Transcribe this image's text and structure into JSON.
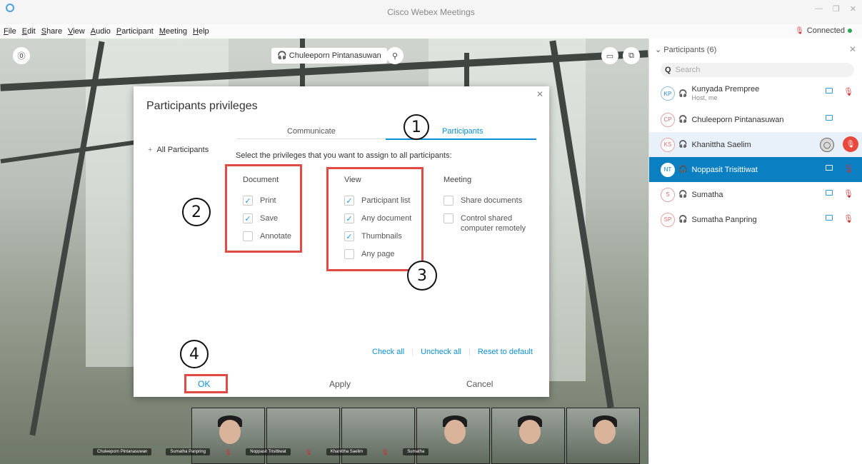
{
  "window": {
    "title": "Cisco Webex Meetings",
    "controls": [
      "—",
      "❐",
      "✕"
    ]
  },
  "menu": [
    "File",
    "Edit",
    "Share",
    "View",
    "Audio",
    "Participant",
    "Meeting",
    "Help"
  ],
  "connection": {
    "status": "Connected",
    "status_color": "#2aa655"
  },
  "stage": {
    "active_speaker": "Chuleeporn Pintanasuwan",
    "thumbnails": [
      {
        "name": "Chuleeporn Pintanasuwan",
        "muted": false
      },
      {
        "name": "Sumatha Panpring",
        "muted": true
      },
      {
        "name": "Noppasit Trisittiwat",
        "muted": true
      },
      {
        "name": "Khanittha Saelim",
        "muted": true
      },
      {
        "name": "Sumatha",
        "muted": true
      }
    ]
  },
  "dialog": {
    "title": "Participants privileges",
    "tabs": [
      {
        "label": "Communicate",
        "active": false
      },
      {
        "label": "Participants",
        "active": true
      }
    ],
    "all_participants": "All Participants",
    "instruction": "Select the privileges that you want to assign to all participants:",
    "columns": {
      "document": {
        "heading": "Document",
        "items": [
          {
            "label": "Print",
            "checked": true
          },
          {
            "label": "Save",
            "checked": true
          },
          {
            "label": "Annotate",
            "checked": false
          }
        ]
      },
      "view": {
        "heading": "View",
        "items": [
          {
            "label": "Participant list",
            "checked": true
          },
          {
            "label": "Any document",
            "checked": true
          },
          {
            "label": "Thumbnails",
            "checked": true
          },
          {
            "label": "Any page",
            "checked": false
          }
        ]
      },
      "meeting": {
        "heading": "Meeting",
        "items": [
          {
            "label": "Share documents",
            "checked": false
          },
          {
            "label": "Control shared computer remotely",
            "checked": false
          }
        ]
      }
    },
    "links": {
      "check_all": "Check all",
      "uncheck_all": "Uncheck all",
      "reset": "Reset to default"
    },
    "buttons": {
      "ok": "OK",
      "apply": "Apply",
      "cancel": "Cancel"
    },
    "annotations": [
      "1",
      "2",
      "3",
      "4"
    ],
    "accent_color": "#0a8fd6",
    "annotation_color": "#e24a45"
  },
  "panel": {
    "header": "Participants (6)",
    "search_placeholder": "Search",
    "participants": [
      {
        "initials": "KP",
        "name": "Kunyada Prempree",
        "role": "Host, me",
        "video": true,
        "muted": true,
        "state": "normal"
      },
      {
        "initials": "CP",
        "name": "Chuleeporn Pintanasuwan",
        "role": "",
        "video": true,
        "muted": false,
        "state": "normal"
      },
      {
        "initials": "KS",
        "name": "Khanittha Saelim",
        "role": "",
        "video": false,
        "muted": true,
        "state": "hover"
      },
      {
        "initials": "NT",
        "name": "Noppasit Trisittiwat",
        "role": "",
        "video": true,
        "muted": true,
        "state": "selected"
      },
      {
        "initials": "S",
        "name": "Sumatha",
        "role": "",
        "video": true,
        "muted": true,
        "state": "normal"
      },
      {
        "initials": "SP",
        "name": "Sumatha Panpring",
        "role": "",
        "video": true,
        "muted": true,
        "state": "normal"
      }
    ]
  }
}
